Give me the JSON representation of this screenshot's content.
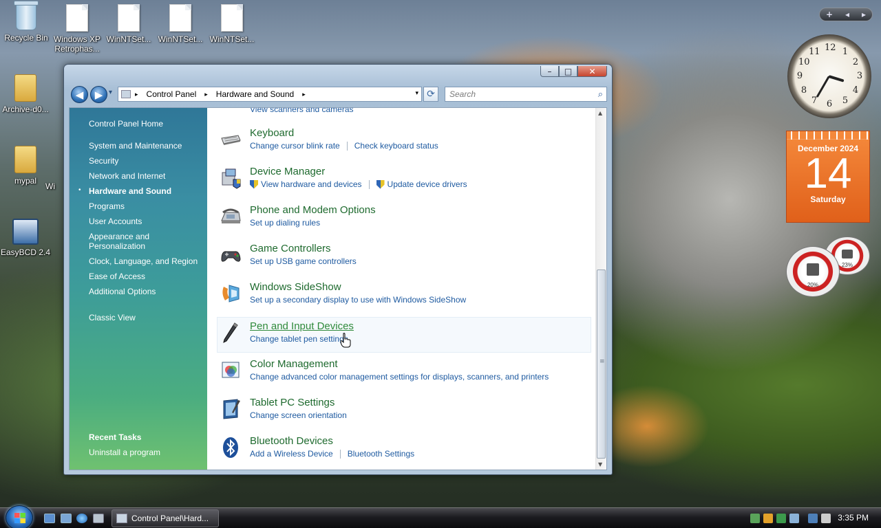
{
  "desktop": {
    "icons": [
      {
        "label": "Recycle Bin"
      },
      {
        "label": "Windows XP Retrophas..."
      },
      {
        "label": "WinNTSet..."
      },
      {
        "label": "WinNTSet..."
      },
      {
        "label": "WinNTSet..."
      },
      {
        "label": "Archive-d0..."
      },
      {
        "label": "mypal"
      },
      {
        "label": "Wi"
      },
      {
        "label": "EasyBCD 2.4"
      }
    ]
  },
  "window": {
    "title_buttons": {
      "minimize": "–",
      "maximize": "□",
      "close": "✕"
    },
    "nav": {
      "back": "◀",
      "forward": "▶",
      "recent": "▾"
    },
    "address": {
      "crumbs": [
        "Control Panel",
        "Hardware and Sound"
      ],
      "sep": "▸",
      "drop": "▾"
    },
    "refresh": "⟳",
    "search": {
      "placeholder": "Search",
      "icon": "⌕"
    },
    "sidebar": {
      "home": "Control Panel Home",
      "categories": [
        "System and Maintenance",
        "Security",
        "Network and Internet",
        "Hardware and Sound",
        "Programs",
        "User Accounts",
        "Appearance and Personalization",
        "Clock, Language, and Region",
        "Ease of Access",
        "Additional Options"
      ],
      "active_bullet": "•",
      "classic_view": "Classic View",
      "recent_tasks_heading": "Recent Tasks",
      "recent_tasks": [
        "Uninstall a program"
      ]
    },
    "top_stub_link": "View scanners and cameras",
    "items": [
      {
        "title": "Keyboard",
        "icon": "keyboard-icon",
        "links": [
          "Change cursor blink rate",
          "Check keyboard status"
        ]
      },
      {
        "title": "Device Manager",
        "icon": "device-manager-icon",
        "links": [
          "View hardware and devices",
          "Update device drivers"
        ]
      },
      {
        "title": "Phone and Modem Options",
        "icon": "phone-modem-icon",
        "links": [
          "Set up dialing rules"
        ]
      },
      {
        "title": "Game Controllers",
        "icon": "gamepad-icon",
        "links": [
          "Set up USB game controllers"
        ]
      },
      {
        "title": "Windows SideShow",
        "icon": "sideshow-icon",
        "links": [
          "Set up a secondary display to use with Windows SideShow"
        ]
      },
      {
        "title": "Pen and Input Devices",
        "icon": "pen-icon",
        "links": [
          "Change tablet pen settings"
        ]
      },
      {
        "title": "Color Management",
        "icon": "color-management-icon",
        "links": [
          "Change advanced color management settings for displays, scanners, and printers"
        ]
      },
      {
        "title": "Tablet PC Settings",
        "icon": "tablet-icon",
        "links": [
          "Change screen orientation"
        ]
      },
      {
        "title": "Bluetooth Devices",
        "icon": "bluetooth-icon",
        "links": [
          "Add a Wireless Device",
          "Bluetooth Settings"
        ]
      }
    ],
    "scroll": {
      "up": "▲",
      "down": "▼",
      "grip": "≡"
    }
  },
  "gadgets": {
    "bar": {
      "add": "+",
      "prev": "◂",
      "next": "▸"
    },
    "clock_numbers": [
      "12",
      "1",
      "2",
      "3",
      "4",
      "5",
      "6",
      "7",
      "8",
      "9",
      "10",
      "11"
    ],
    "calendar": {
      "month": "December 2024",
      "day": "14",
      "weekday": "Saturday"
    },
    "cpu_meter": {
      "cpu": "20%",
      "memory": "23%"
    }
  },
  "taskbar": {
    "window_item": "Control Panel\\Hard...",
    "clock": "3:35 PM"
  },
  "colors": {
    "link": "#1e5aa0",
    "title_green": "#1e6a2e",
    "calendar": "#e0601a"
  }
}
